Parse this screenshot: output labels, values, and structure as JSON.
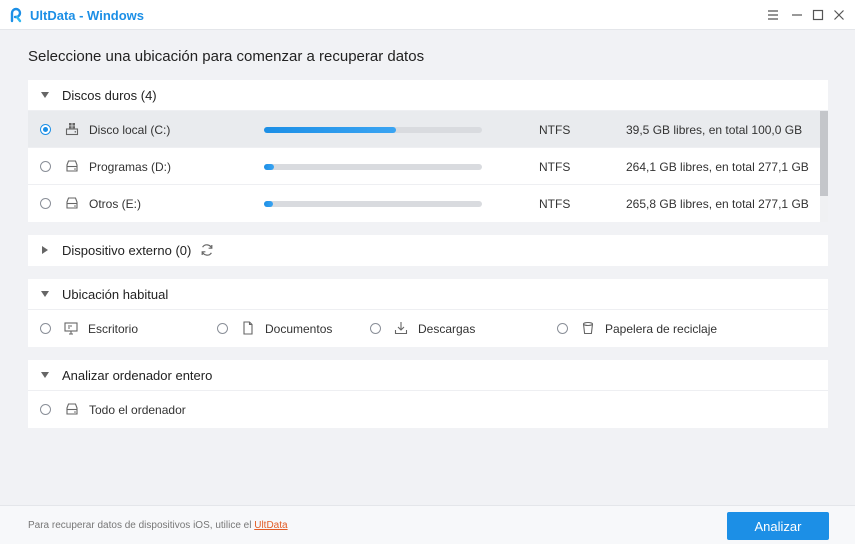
{
  "window": {
    "title": "UltData - Windows",
    "controls": [
      "menu-icon",
      "minimize-icon",
      "maximize-icon",
      "close-icon"
    ]
  },
  "heading": "Seleccione una ubicación para comenzar a recuperar datos",
  "hard_drives": {
    "title": "Discos duros (4)",
    "drives": [
      {
        "name": "Disco local (C:)",
        "icon": "windows-drive-icon",
        "fs": "NTFS",
        "space": "39,5 GB libres, en total 100,0 GB",
        "used_fraction": 0.605,
        "selected": true
      },
      {
        "name": "Programas (D:)",
        "icon": "drive-icon",
        "fs": "NTFS",
        "space": "264,1 GB libres, en total 277,1 GB",
        "used_fraction": 0.047,
        "selected": false
      },
      {
        "name": "Otros (E:)",
        "icon": "drive-icon",
        "fs": "NTFS",
        "space": "265,8 GB libres, en total 277,1 GB",
        "used_fraction": 0.041,
        "selected": false
      }
    ]
  },
  "external": {
    "title": "Dispositivo externo (0)"
  },
  "common_locations": {
    "title": "Ubicación habitual",
    "items": [
      {
        "label": "Escritorio",
        "icon": "desktop-icon"
      },
      {
        "label": "Documentos",
        "icon": "document-icon"
      },
      {
        "label": "Descargas",
        "icon": "download-icon"
      },
      {
        "label": "Papelera de reciclaje",
        "icon": "recycle-bin-icon"
      }
    ]
  },
  "whole_computer": {
    "title": "Analizar ordenador entero",
    "item": {
      "label": "Todo el ordenador",
      "icon": "drive-icon"
    }
  },
  "footer": {
    "note": "Para recuperar datos de dispositivos iOS, utilice el ",
    "link": "UltData",
    "scan_button": "Analizar"
  },
  "colors": {
    "accent": "#1c8fe6",
    "link": "#e25c26",
    "background": "#f1f2f5"
  }
}
